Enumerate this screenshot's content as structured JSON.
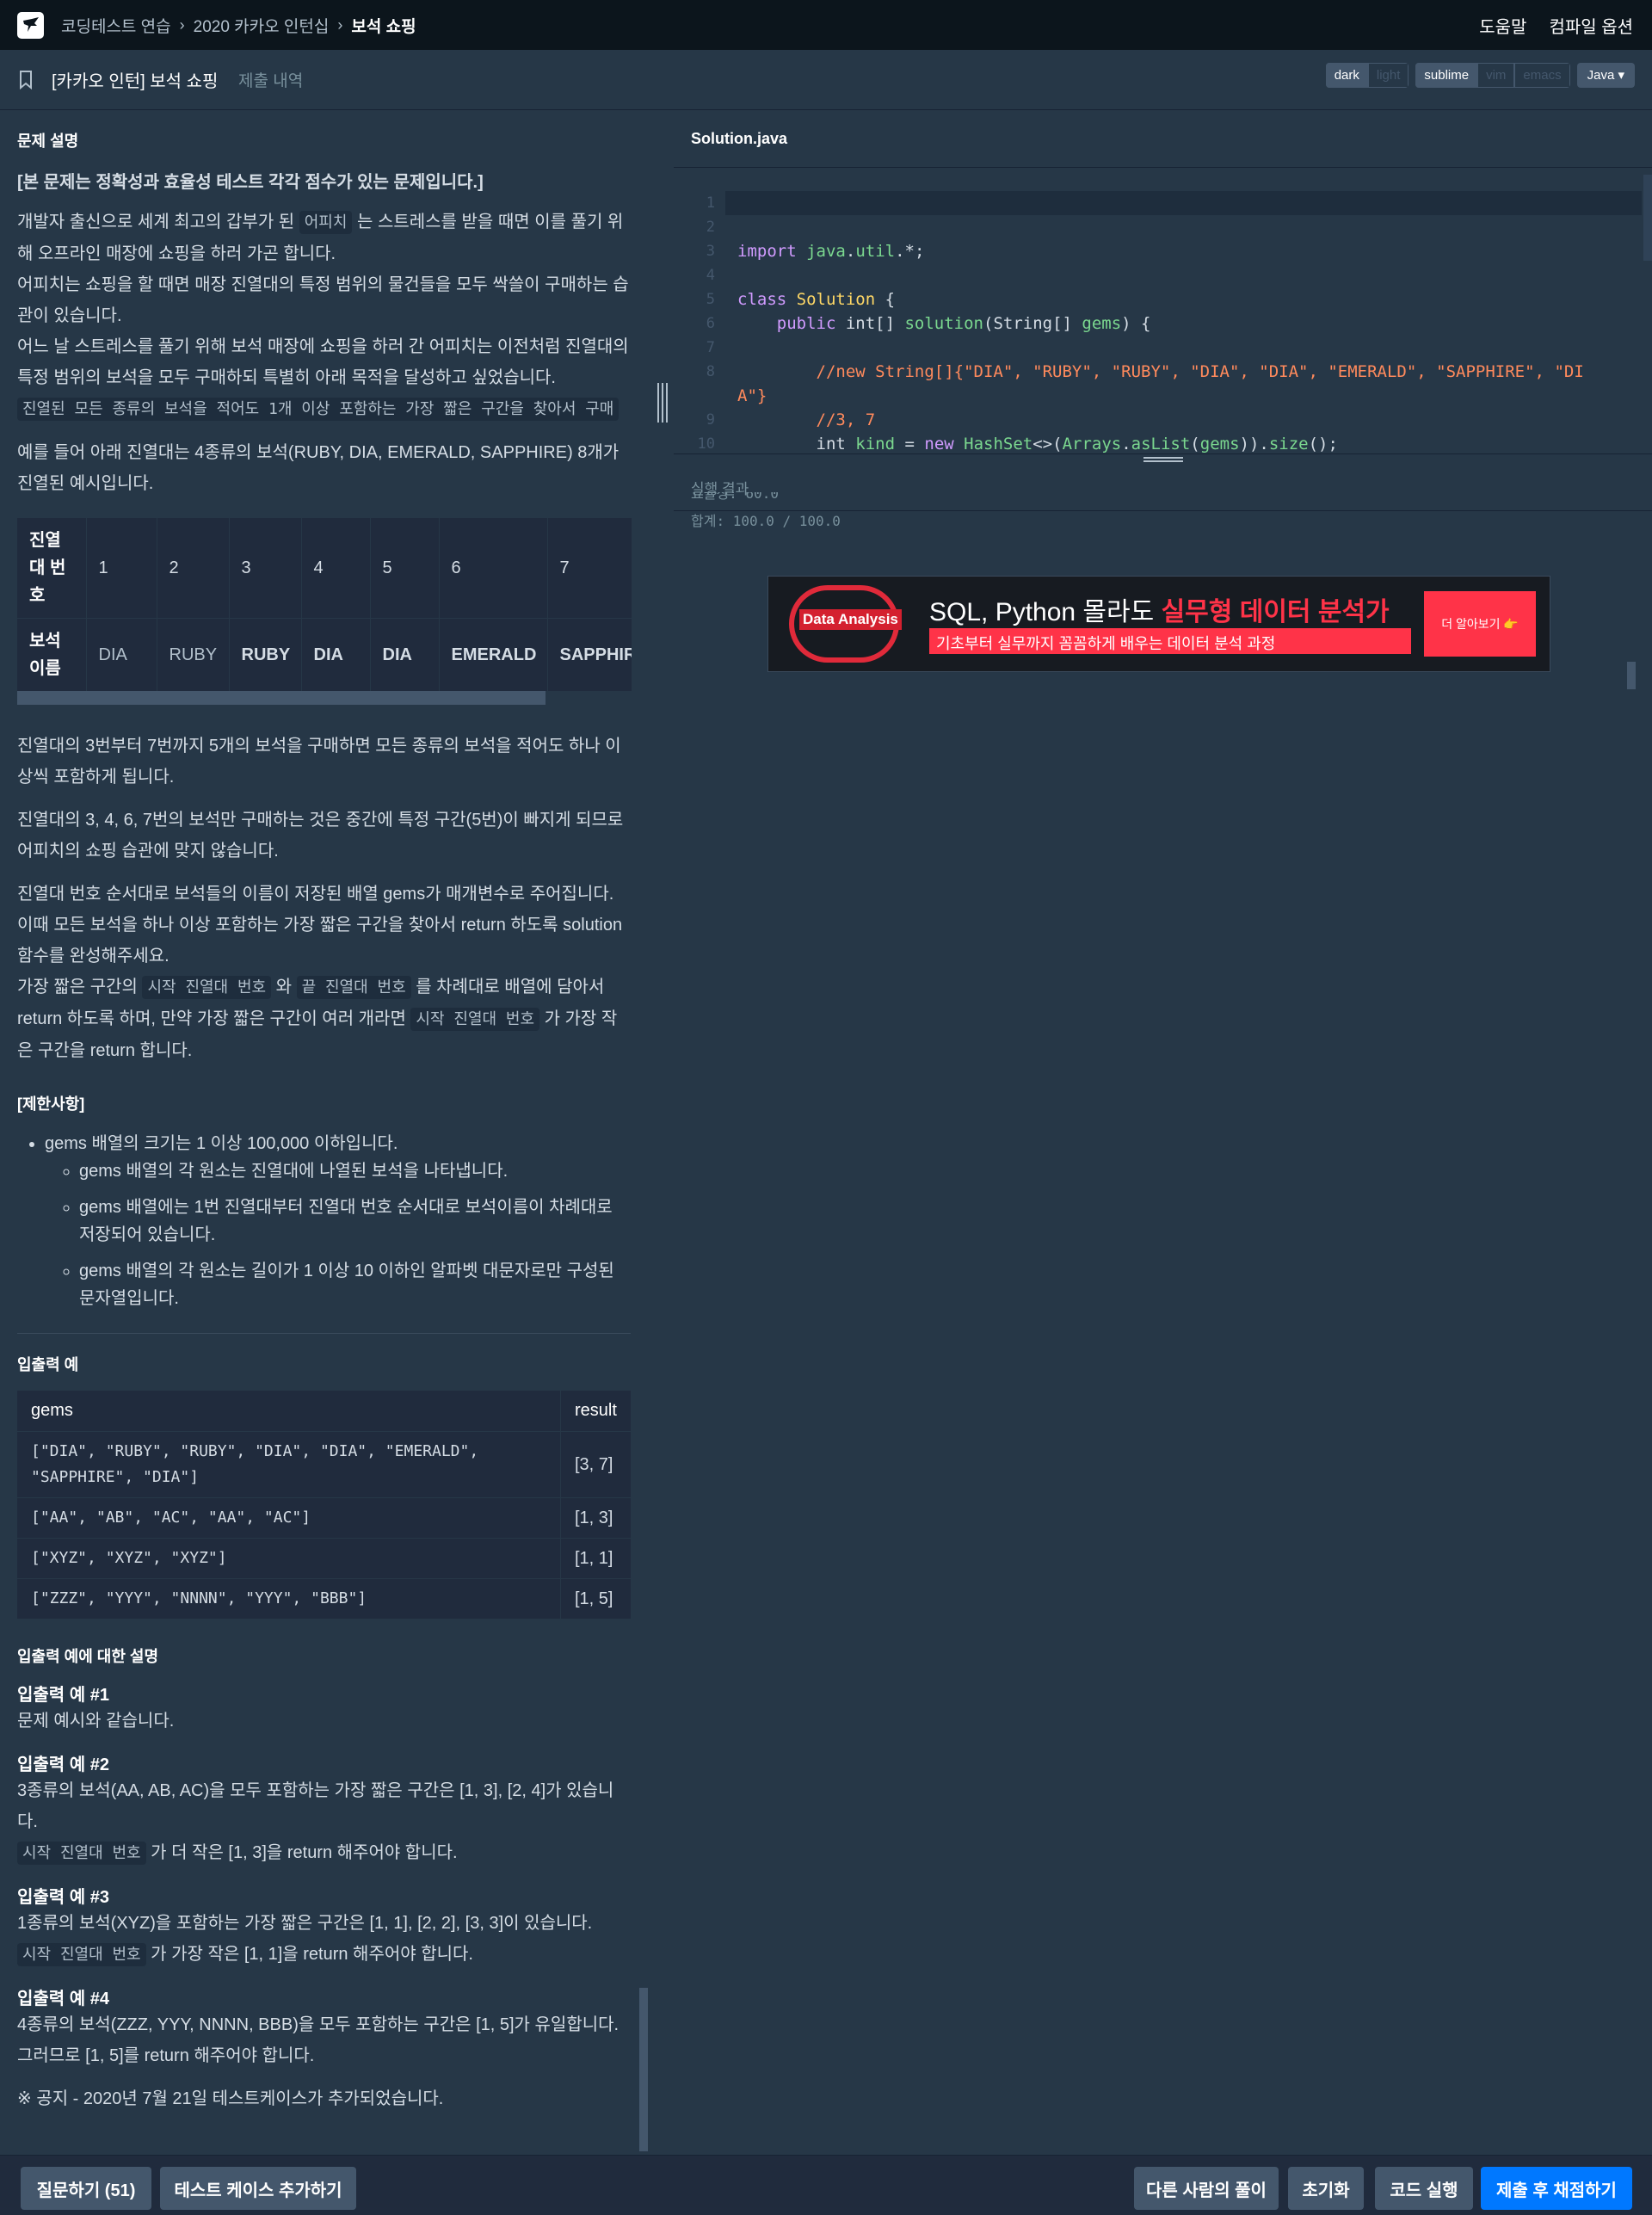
{
  "nav": {
    "breadcrumbs": [
      "코딩테스트 연습",
      "2020 카카오 인턴십",
      "보석 쇼핑"
    ],
    "help": "도움말",
    "compile_options": "컴파일 옵션"
  },
  "tabs": {
    "active": "[카카오 인턴] 보석 쇼핑",
    "submissions": "제출 내역"
  },
  "editor_options": {
    "themes": [
      "dark",
      "light"
    ],
    "keymaps": [
      "sublime",
      "vim",
      "emacs"
    ],
    "language": "Java"
  },
  "problem": {
    "section_title": "문제 설명",
    "intro_bold": "[본 문제는 정확성과 효율성 테스트 각각 점수가 있는 문제입니다.]",
    "p1_a": "개발자 출신으로 세계 최고의 갑부가 된 ",
    "p1_code": "어피치",
    "p1_b": " 는 스트레스를 받을 때면 이를 풀기 위해 오프라인 매장에 쇼핑을 하러 가곤 합니다.",
    "p2": "어피치는 쇼핑을 할 때면 매장 진열대의 특정 범위의 물건들을 모두 싹쓸이 구매하는 습관이 있습니다.",
    "p3": "어느 날 스트레스를 풀기 위해 보석 매장에 쇼핑을 하러 간 어피치는 이전처럼 진열대의 특정 범위의 보석을 모두 구매하되 특별히 아래 목적을 달성하고 싶었습니다.",
    "p3_code": "진열된 모든 종류의 보석을 적어도 1개 이상 포함하는 가장 짧은 구간을 찾아서 구매",
    "p4": "예를 들어 아래 진열대는 4종류의 보석(RUBY, DIA, EMERALD, SAPPHIRE) 8개가 진열된 예시입니다.",
    "table_header_num": "진열대 번호",
    "table_header_name": "보석 이름",
    "table_nums": [
      "1",
      "2",
      "3",
      "4",
      "5",
      "6",
      "7"
    ],
    "table_gems": [
      "DIA",
      "RUBY",
      "RUBY",
      "DIA",
      "DIA",
      "EMERALD",
      "SAPPHIRE"
    ],
    "p5": "진열대의 3번부터 7번까지 5개의 보석을 구매하면 모든 종류의 보석을 적어도 하나 이상씩 포함하게 됩니다.",
    "p6": "진열대의 3, 4, 6, 7번의 보석만 구매하는 것은 중간에 특정 구간(5번)이 빠지게 되므로 어피치의 쇼핑 습관에 맞지 않습니다.",
    "p7": "진열대 번호 순서대로 보석들의 이름이 저장된 배열 gems가 매개변수로 주어집니다. 이때 모든 보석을 하나 이상 포함하는 가장 짧은 구간을 찾아서 return 하도록 solution 함수를 완성해주세요.",
    "p8_a": "가장 짧은 구간의 ",
    "p8_code1": "시작 진열대 번호",
    "p8_b": " 와 ",
    "p8_code2": "끝 진열대 번호",
    "p8_c": " 를 차례대로 배열에 담아서 return 하도록 하며, 만약 가장 짧은 구간이 여러 개라면 ",
    "p8_code3": "시작 진열대 번호",
    "p8_d": " 가 가장 작은 구간을 return 합니다.",
    "constraints_title": "[제한사항]",
    "c1": "gems 배열의 크기는 1 이상 100,000 이하입니다.",
    "c1a": "gems 배열의 각 원소는 진열대에 나열된 보석을 나타냅니다.",
    "c1b": "gems 배열에는 1번 진열대부터 진열대 번호 순서대로 보석이름이 차례대로 저장되어 있습니다.",
    "c1c": "gems 배열의 각 원소는 길이가 1 이상 10 이하인 알파벳 대문자로만 구성된 문자열입니다.",
    "io_title": "입출력 예",
    "io_headers": [
      "gems",
      "result"
    ],
    "io_rows": [
      {
        "gems": "[\"DIA\", \"RUBY\", \"RUBY\", \"DIA\", \"DIA\", \"EMERALD\", \"SAPPHIRE\", \"DIA\"]",
        "result": "[3, 7]"
      },
      {
        "gems": "[\"AA\", \"AB\", \"AC\", \"AA\", \"AC\"]",
        "result": "[1, 3]"
      },
      {
        "gems": "[\"XYZ\", \"XYZ\", \"XYZ\"]",
        "result": "[1, 1]"
      },
      {
        "gems": "[\"ZZZ\", \"YYY\", \"NNNN\", \"YYY\", \"BBB\"]",
        "result": "[1, 5]"
      }
    ],
    "io_explain_title": "입출력 예에 대한 설명",
    "ex1_title": "입출력 예 #1",
    "ex1": "문제 예시와 같습니다.",
    "ex2_title": "입출력 예 #2",
    "ex2": "3종류의 보석(AA, AB, AC)을 모두 포함하는 가장 짧은 구간은 [1, 3], [2, 4]가 있습니다.",
    "ex2_code": "시작 진열대 번호",
    "ex2_b": " 가 더 작은 [1, 3]을 return 해주어야 합니다.",
    "ex3_title": "입출력 예 #3",
    "ex3": "1종류의 보석(XYZ)을 포함하는 가장 짧은 구간은 [1, 1], [2, 2], [3, 3]이 있습니다.",
    "ex3_code": "시작 진열대 번호",
    "ex3_b": " 가 가장 작은 [1, 1]을 return 해주어야 합니다.",
    "ex4_title": "입출력 예 #4",
    "ex4": "4종류의 보석(ZZZ, YYY, NNNN, BBB)을 모두 포함하는 구간은 [1, 5]가 유일합니다.",
    "ex4_b": "그러므로 [1, 5]를 return 해주어야 합니다.",
    "notice": "※ 공지 - 2020년 7월 21일 테스트케이스가 추가되었습니다."
  },
  "editor": {
    "filename": "Solution.java",
    "line_numbers": [
      "1",
      "2",
      "3",
      "4",
      "5",
      "6",
      "7",
      "8",
      "",
      "9",
      "10"
    ]
  },
  "result": {
    "title": "실행 결과",
    "line_partial": "효율성: 60.0",
    "total": "합계: 100.0 / 100.0"
  },
  "ad": {
    "logo_text": "Data Analysis",
    "headline_a": "SQL, Python 몰라도 ",
    "headline_b": "실무형 데이터 분석가",
    "subline": "기초부터 실무까지 꼼꼼하게 배우는 데이터 분석 과정",
    "button": "더 알아보기 👉"
  },
  "bottom": {
    "ask": "질문하기 (51)",
    "add_testcase": "테스트 케이스 추가하기",
    "others": "다른 사람의 풀이",
    "reset": "초기화",
    "run": "코드 실행",
    "submit": "제출 후 채점하기"
  },
  "colors": {
    "bg": "#263747",
    "nav": "#0c151c",
    "primary": "#0078ff",
    "button": "#44576c"
  }
}
